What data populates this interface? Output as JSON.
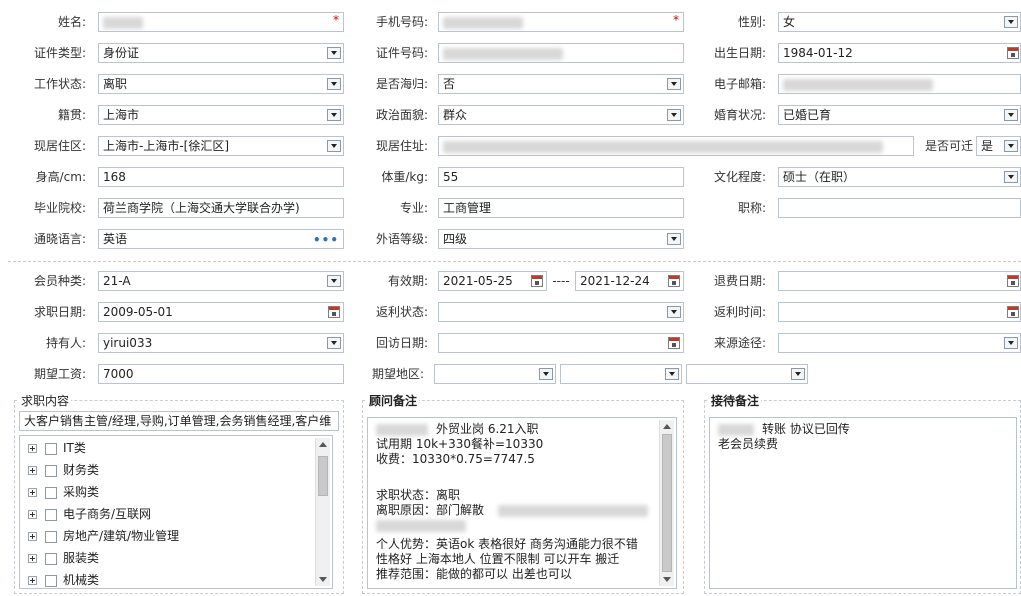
{
  "row1": {
    "name_label": "姓名:",
    "phone_label": "手机号码:",
    "gender_label": "性别:",
    "gender_value": "女",
    "required_mark": "*"
  },
  "row2": {
    "idtype_label": "证件类型:",
    "idtype_value": "身份证",
    "idnum_label": "证件号码:",
    "birth_label": "出生日期:",
    "birth_value": "1984-01-12"
  },
  "row3": {
    "work_label": "工作状态:",
    "work_value": "离职",
    "abroad_label": "是否海归:",
    "abroad_value": "否",
    "email_label": "电子邮箱:"
  },
  "row4": {
    "native_label": "籍贯:",
    "native_value": "上海市",
    "political_label": "政治面貌:",
    "political_value": "群众",
    "marital_label": "婚育状况:",
    "marital_value": "已婚已育"
  },
  "row5": {
    "area_label": "现居住区:",
    "area_value": "上海市-上海市-[徐汇区]",
    "address_label": "现居住址:",
    "relocate_label": "是否可迁",
    "relocate_value": "是"
  },
  "row6": {
    "height_label": "身高/cm:",
    "height_value": "168",
    "weight_label": "体重/kg:",
    "weight_value": "55",
    "edu_label": "文化程度:",
    "edu_value": "硕士（在职）"
  },
  "row7": {
    "school_label": "毕业院校:",
    "school_value": "荷兰商学院（上海交通大学联合办学)",
    "major_label": "专业:",
    "major_value": "工商管理",
    "title_label": "职称:",
    "title_value": ""
  },
  "row8": {
    "lang_label": "通晓语言:",
    "lang_value": "英语",
    "lang_more": "•••",
    "level_label": "外语等级:",
    "level_value": "四级"
  },
  "row9": {
    "member_label": "会员种类:",
    "member_value": "21-A",
    "valid_label": "有效期:",
    "valid_start": "2021-05-25",
    "valid_sep": "----",
    "valid_end": "2021-12-24",
    "refund_label": "退费日期:",
    "refund_value": ""
  },
  "row10": {
    "job_date_label": "求职日期:",
    "job_date_value": "2009-05-01",
    "rebate_label": "返利状态:",
    "rebate_value": "",
    "rebate_time_label": "返利时间:",
    "rebate_time_value": ""
  },
  "row11": {
    "holder_label": "持有人:",
    "holder_value": "yirui033",
    "visit_label": "回访日期:",
    "visit_value": "",
    "source_label": "来源途径:",
    "source_value": ""
  },
  "row12": {
    "salary_label": "期望工资:",
    "salary_value": "7000",
    "region_label": "期望地区:"
  },
  "job_panel": {
    "title": "求职内容",
    "summary": "大客户销售主管/经理,导购,订单管理,会务销售经理,客户维",
    "tree": [
      "IT类",
      "财务类",
      "采购类",
      "电子商务/互联网",
      "房地产/建筑/物业管理",
      "服装类",
      "机械类"
    ]
  },
  "advisor_panel": {
    "title": "顾问备注",
    "lines": [
      {
        "text": "外贸业岗  6.21入职",
        "blur_before": 52
      },
      {
        "text": "试用期 10k+330餐补=10330"
      },
      {
        "text": "收费：10330*0.75=7747.5"
      },
      {
        "text": ""
      },
      {
        "text": "求职状态：离职"
      },
      {
        "text": "离职原因：部门解散",
        "blur_after": 160
      },
      {
        "text": "",
        "blur_before": 90
      },
      {
        "text": "个人优势：英语ok 表格很好 商务沟通能力很不错"
      },
      {
        "text": "性格好 上海本地人 位置不限制 可以开车 搬迁"
      },
      {
        "text": "推荐范围：能做的都可以 出差也可以"
      }
    ]
  },
  "reception_panel": {
    "title": "接待备注",
    "line1": "转账 协议已回传",
    "line2": "老会员续费"
  }
}
